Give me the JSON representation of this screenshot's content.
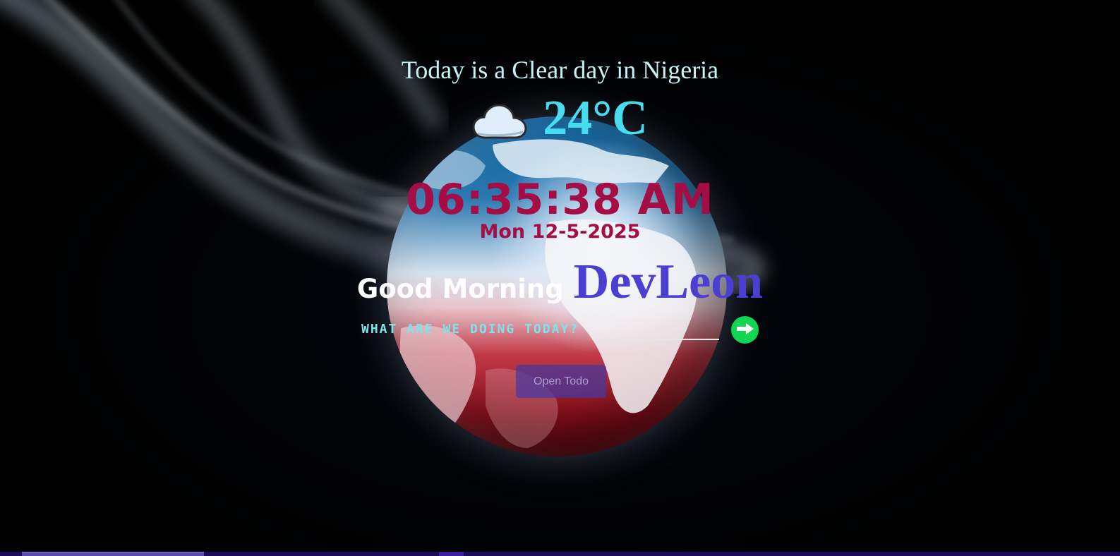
{
  "weather": {
    "description": "Today is a Clear day in Nigeria",
    "icon": "cloud-icon",
    "temperature": "24°C"
  },
  "clock": {
    "time": "06:35:38 AM",
    "date": "Mon 12-5-2025"
  },
  "greeting": {
    "text": "Good Morning",
    "name": "DevLeon"
  },
  "todo": {
    "prompt": "WHAT ARE WE DOING TODAY?",
    "input_value": "",
    "submit_icon": "arrow-right-icon",
    "open_button_label": "Open Todo"
  },
  "colors": {
    "temperature": "#48dcf0",
    "clock": "#a50d45",
    "name": "#4a3fd1",
    "submit": "#12d651",
    "open_button": "#4637a0"
  }
}
